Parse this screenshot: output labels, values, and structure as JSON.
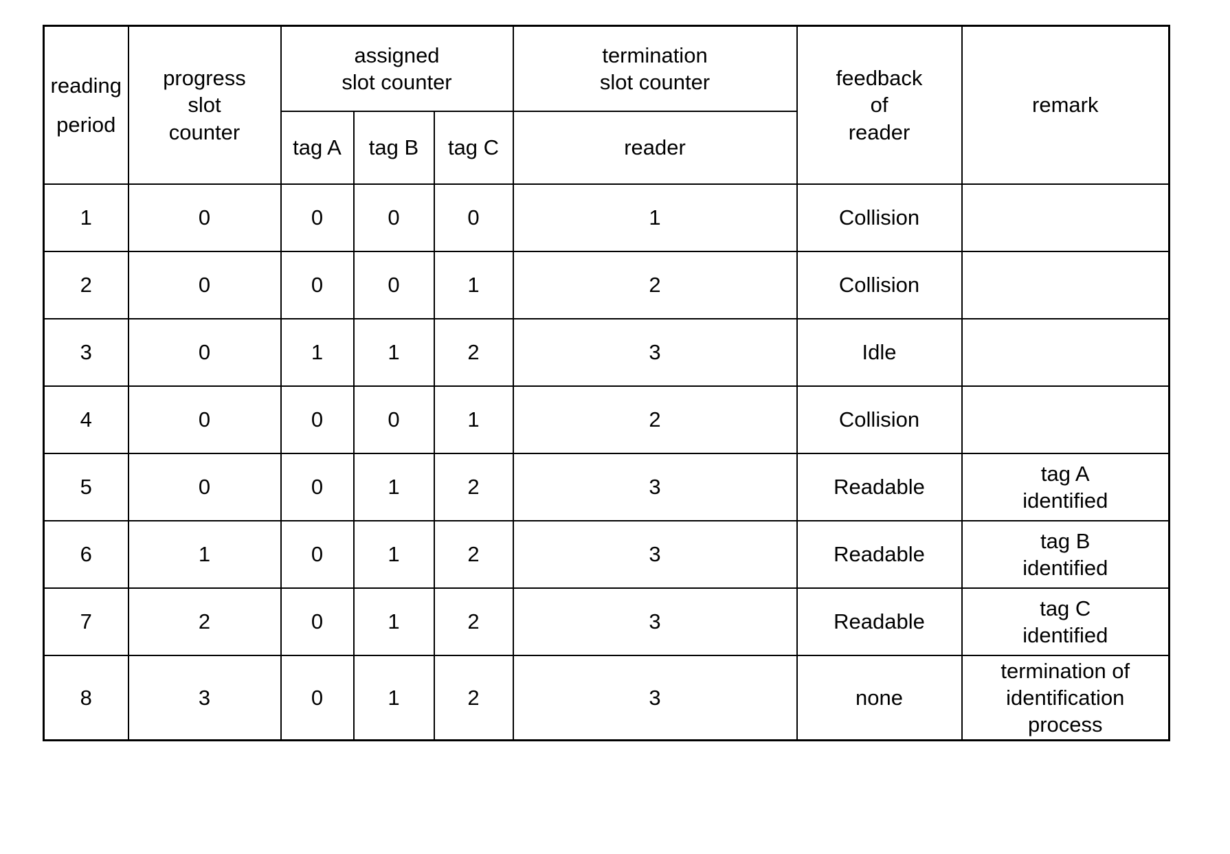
{
  "table": {
    "headers": {
      "reading_period": {
        "line1": "reading",
        "line2": "period"
      },
      "progress_slot_counter": {
        "line1": "progress",
        "line2": "slot",
        "line3": "counter"
      },
      "assigned_slot_counter": {
        "line1": "assigned",
        "line2": "slot counter"
      },
      "termination_slot_counter": {
        "line1": "termination",
        "line2": "slot counter"
      },
      "feedback_of_reader": {
        "line1": "feedback",
        "line2": "of",
        "line3": "reader"
      },
      "remark": "remark",
      "sub": {
        "tag_a": "tag A",
        "tag_b": "tag B",
        "tag_c": "tag C",
        "reader": "reader"
      }
    },
    "columns": [
      "reading period",
      "progress slot counter",
      "tag A",
      "tag B",
      "tag C",
      "reader",
      "feedback of reader",
      "remark"
    ],
    "rows": [
      {
        "reading_period": "1",
        "progress_slot_counter": "0",
        "tag_a": "0",
        "tag_b": "0",
        "tag_c": "0",
        "reader": "1",
        "feedback": "Collision",
        "remark": {
          "line1": "",
          "line2": "",
          "line3": ""
        }
      },
      {
        "reading_period": "2",
        "progress_slot_counter": "0",
        "tag_a": "0",
        "tag_b": "0",
        "tag_c": "1",
        "reader": "2",
        "feedback": "Collision",
        "remark": {
          "line1": "",
          "line2": "",
          "line3": ""
        }
      },
      {
        "reading_period": "3",
        "progress_slot_counter": "0",
        "tag_a": "1",
        "tag_b": "1",
        "tag_c": "2",
        "reader": "3",
        "feedback": "Idle",
        "remark": {
          "line1": "",
          "line2": "",
          "line3": ""
        }
      },
      {
        "reading_period": "4",
        "progress_slot_counter": "0",
        "tag_a": "0",
        "tag_b": "0",
        "tag_c": "1",
        "reader": "2",
        "feedback": "Collision",
        "remark": {
          "line1": "",
          "line2": "",
          "line3": ""
        }
      },
      {
        "reading_period": "5",
        "progress_slot_counter": "0",
        "tag_a": "0",
        "tag_b": "1",
        "tag_c": "2",
        "reader": "3",
        "feedback": "Readable",
        "remark": {
          "line1": "tag A",
          "line2": "identified",
          "line3": ""
        }
      },
      {
        "reading_period": "6",
        "progress_slot_counter": "1",
        "tag_a": "0",
        "tag_b": "1",
        "tag_c": "2",
        "reader": "3",
        "feedback": "Readable",
        "remark": {
          "line1": "tag B",
          "line2": "identified",
          "line3": ""
        }
      },
      {
        "reading_period": "7",
        "progress_slot_counter": "2",
        "tag_a": "0",
        "tag_b": "1",
        "tag_c": "2",
        "reader": "3",
        "feedback": "Readable",
        "remark": {
          "line1": "tag C",
          "line2": "identified",
          "line3": ""
        }
      },
      {
        "reading_period": "8",
        "progress_slot_counter": "3",
        "tag_a": "0",
        "tag_b": "1",
        "tag_c": "2",
        "reader": "3",
        "feedback": "none",
        "remark": {
          "line1": "termination of",
          "line2": "identification",
          "line3": "process"
        }
      }
    ]
  },
  "colors": {
    "border": "#000000",
    "text": "#000000",
    "background": "#ffffff"
  }
}
